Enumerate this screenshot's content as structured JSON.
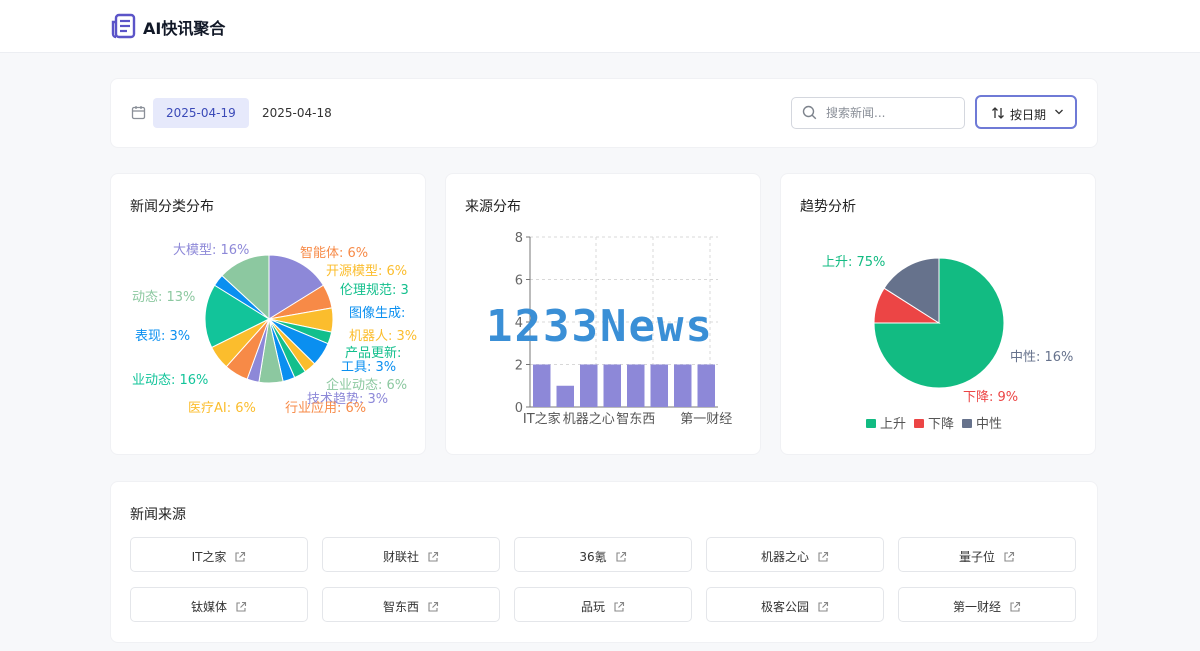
{
  "app": {
    "title": "AI快讯聚合",
    "logo_icon": "newspaper-icon"
  },
  "toolbar": {
    "dates": [
      "2025-04-19",
      "2025-04-18"
    ],
    "selected_date": "2025-04-19",
    "search_placeholder": "搜索新闻...",
    "sort_label": "按日期",
    "calendar_icon": "calendar-icon",
    "search_icon": "search-icon"
  },
  "panels": {
    "category": {
      "title": "新闻分类分布"
    },
    "source": {
      "title": "来源分布"
    },
    "trend": {
      "title": "趋势分析"
    }
  },
  "chart_data": [
    {
      "type": "pie",
      "title": "新闻分类分布",
      "slices": [
        {
          "label": "大模型",
          "value": 16,
          "color": "#8d88d8"
        },
        {
          "label": "智能体",
          "value": 6,
          "color": "#f78a47"
        },
        {
          "label": "开源模型",
          "value": 6,
          "color": "#fbbd2d"
        },
        {
          "label": "伦理规范",
          "value": 3,
          "color": "#12bf8c"
        },
        {
          "label": "图像生成",
          "value": 6,
          "color": "#0a8ff0"
        },
        {
          "label": "机器人",
          "value": 3,
          "color": "#fbbd2d"
        },
        {
          "label": "产品更新",
          "value": 3,
          "color": "#12bf8c"
        },
        {
          "label": "工具",
          "value": 3,
          "color": "#0a8ff0"
        },
        {
          "label": "企业动态",
          "value": 6,
          "color": "#8cc8a0"
        },
        {
          "label": "技术趋势",
          "value": 3,
          "color": "#8d88d8"
        },
        {
          "label": "行业应用",
          "value": 6,
          "color": "#f78a47"
        },
        {
          "label": "医疗AI",
          "value": 6,
          "color": "#fbbd2d"
        },
        {
          "label": "行业动态",
          "value": 16,
          "color": "#12c49a"
        },
        {
          "label": "表现",
          "value": 3,
          "color": "#0a8ff0"
        },
        {
          "label": "动态",
          "value": 13,
          "color": "#8cc8a0"
        }
      ],
      "label_texts": [
        "大模型: 16%",
        "智能体: 6%",
        "开源模型: 6%",
        "伦理规范: 3",
        "图像生成:",
        "机器人: 3%",
        "产品更新:",
        "工具: 3%",
        "企业动态: 6%",
        "技术趋势: 3%",
        "行业应用: 6%",
        "医疗AI: 6%",
        "业动态: 16%",
        "表现: 3%",
        "动态: 13%"
      ]
    },
    {
      "type": "bar",
      "title": "来源分布",
      "categories": [
        "IT之家",
        "",
        "机器之心",
        "",
        "智东西",
        "",
        "",
        "第一财经"
      ],
      "values": [
        2,
        1,
        2,
        2,
        2,
        2,
        2,
        2
      ],
      "ylim": [
        0,
        8
      ],
      "yticks": [
        "0",
        "2",
        "4",
        "6",
        "8"
      ],
      "bar_color": "#8d88d8",
      "grid": true
    },
    {
      "type": "pie",
      "title": "趋势分析",
      "slices": [
        {
          "label": "上升",
          "value": 75,
          "color": "#12bb82"
        },
        {
          "label": "下降",
          "value": 9,
          "color": "#ec4545"
        },
        {
          "label": "中性",
          "value": 16,
          "color": "#66728c"
        }
      ],
      "label_texts": [
        "上升: 75%",
        "下降: 9%",
        "中性: 16%"
      ],
      "legend": "bottom"
    }
  ],
  "sources": {
    "title": "新闻来源",
    "items": [
      "IT之家",
      "财联社",
      "36氪",
      "机器之心",
      "量子位",
      "钛媒体",
      "智东西",
      "品玩",
      "极客公园",
      "第一财经"
    ],
    "link_icon": "external-link-icon"
  },
  "watermark": {
    "text": "1233News"
  }
}
